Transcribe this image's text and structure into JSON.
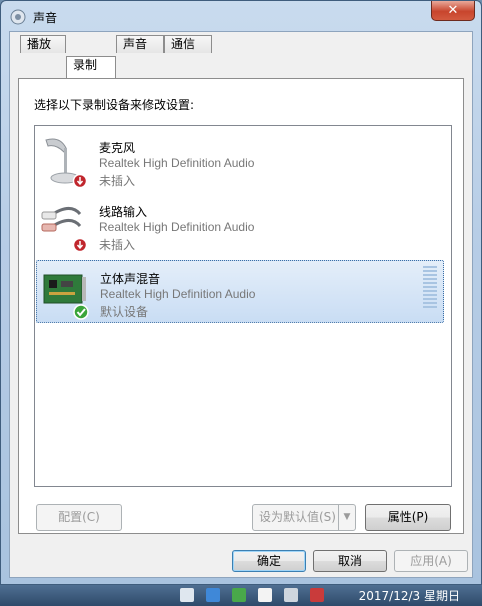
{
  "window": {
    "title": "声音"
  },
  "tabs": [
    {
      "label": "播放",
      "active": false
    },
    {
      "label": "录制",
      "active": true
    },
    {
      "label": "声音",
      "active": false
    },
    {
      "label": "通信",
      "active": false
    }
  ],
  "instruction": "选择以下录制设备来修改设置:",
  "devices": [
    {
      "name": "麦克风",
      "description": "Realtek High Definition Audio",
      "status": "未插入",
      "icon": "microphone-icon",
      "badge": "unplugged-badge-icon",
      "selected": false
    },
    {
      "name": "线路输入",
      "description": "Realtek High Definition Audio",
      "status": "未插入",
      "icon": "line-in-cable-icon",
      "badge": "unplugged-badge-icon",
      "selected": false
    },
    {
      "name": "立体声混音",
      "description": "Realtek High Definition Audio",
      "status": "默认设备",
      "icon": "sound-card-icon",
      "badge": "default-check-icon",
      "selected": true
    }
  ],
  "buttons": {
    "configure": "配置(C)",
    "set_default": "设为默认值(S)",
    "properties": "属性(P)",
    "ok": "确定",
    "cancel": "取消",
    "apply": "应用(A)"
  },
  "taskbar": {
    "clock": "2017/12/3 星期日"
  },
  "colors": {
    "selection": "#cfe1f5",
    "accent": "#3c7fb1",
    "close": "#c8452d"
  }
}
